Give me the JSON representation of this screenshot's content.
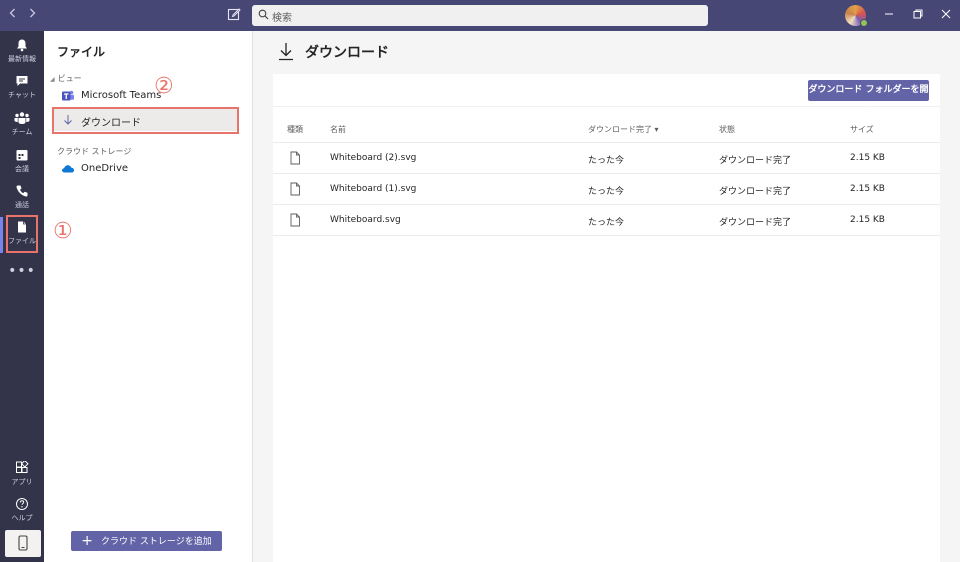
{
  "titlebar": {
    "back_icon": "chevron-left-icon",
    "forward_icon": "chevron-right-icon",
    "search_placeholder": "検索"
  },
  "rail": {
    "items": [
      {
        "icon": "bell-icon",
        "label": "最新情報"
      },
      {
        "icon": "chat-icon",
        "label": "チャット"
      },
      {
        "icon": "teams-icon",
        "label": "チーム"
      },
      {
        "icon": "calendar-icon",
        "label": "会議"
      },
      {
        "icon": "phone-icon",
        "label": "通話"
      },
      {
        "icon": "file-icon",
        "label": "ファイル"
      }
    ],
    "more": "•••",
    "bottom_items": [
      {
        "icon": "apps-icon",
        "label": "アプリ"
      },
      {
        "icon": "help-icon",
        "label": "ヘルプ"
      }
    ]
  },
  "panel": {
    "title": "ファイル",
    "view_section": "ビュー",
    "items": [
      {
        "label": "Microsoft Teams",
        "icon": "teams-logo-icon"
      },
      {
        "label": "ダウンロード",
        "icon": "download-icon"
      }
    ],
    "cloud_section": "クラウド ストレージ",
    "cloud_items": [
      {
        "label": "OneDrive",
        "icon": "onedrive-icon"
      }
    ],
    "add_storage": "クラウド ストレージを追加"
  },
  "annotations": {
    "marker_1": "①",
    "marker_2": "②",
    "color": "#e8736b"
  },
  "main": {
    "title": "ダウンロード",
    "open_folder": "ダウンロード フォルダーを開く",
    "columns": {
      "type": "種類",
      "name": "名前",
      "completed": "ダウンロード完了 ▾",
      "status": "状態",
      "size": "サイズ"
    },
    "rows": [
      {
        "name": "Whiteboard (2).svg",
        "completed": "たった今",
        "status": "ダウンロード完了",
        "size": "2.15 KB"
      },
      {
        "name": "Whiteboard (1).svg",
        "completed": "たった今",
        "status": "ダウンロード完了",
        "size": "2.15 KB"
      },
      {
        "name": "Whiteboard.svg",
        "completed": "たった今",
        "status": "ダウンロード完了",
        "size": "2.15 KB"
      }
    ]
  },
  "colors": {
    "titlebar": "#464775",
    "rail": "#33344a",
    "accent": "#6264a7",
    "highlight": "#e8736b"
  }
}
